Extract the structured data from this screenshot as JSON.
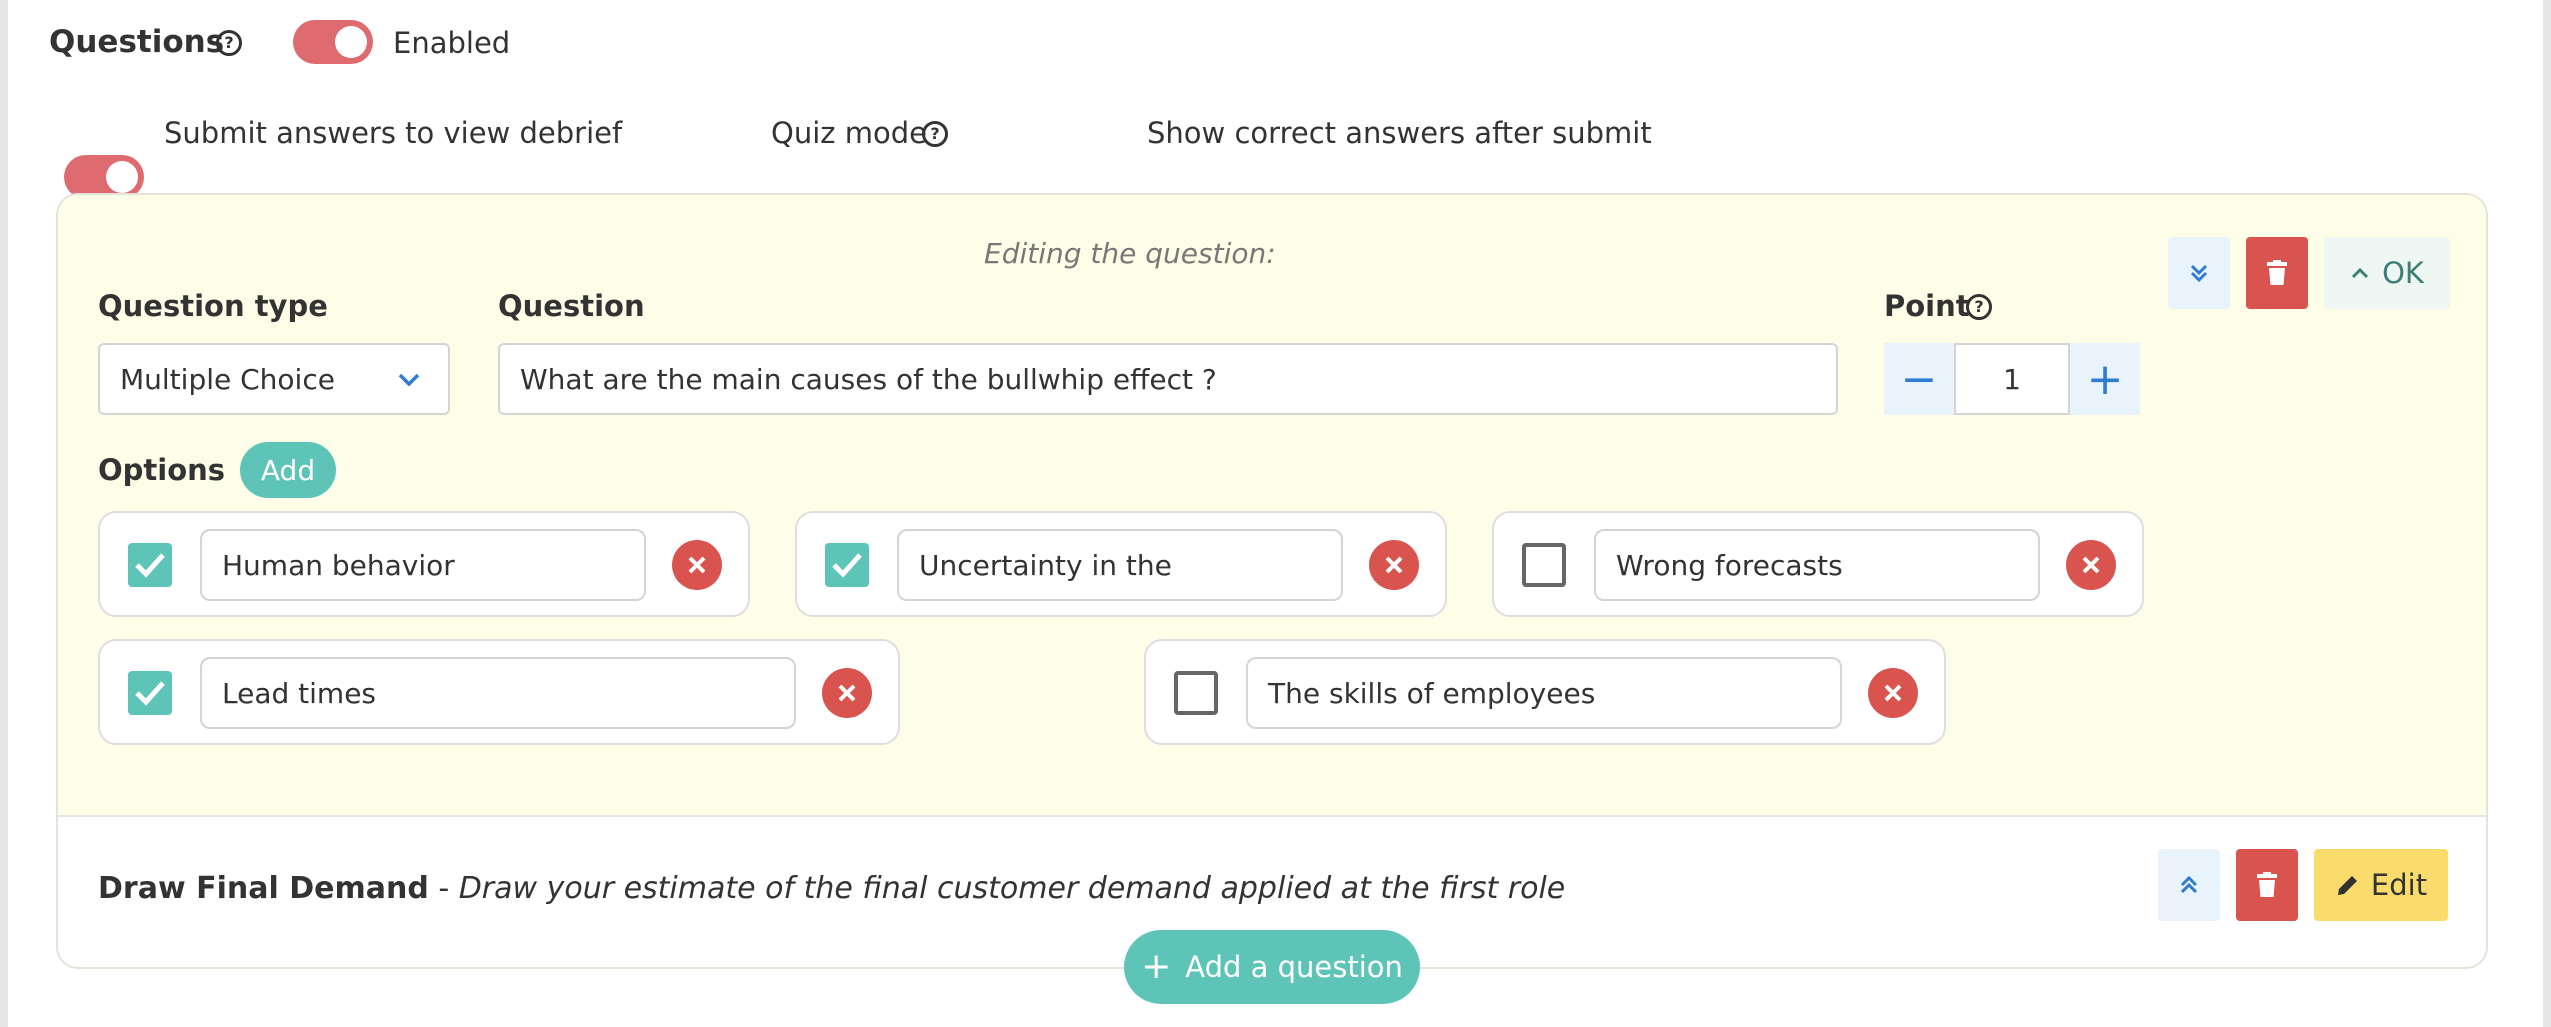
{
  "header": {
    "title": "Questions",
    "enabled_label": "Enabled"
  },
  "settings": {
    "submit_label": "Submit answers to view debrief",
    "quiz_mode_label": "Quiz mode",
    "show_correct_label": "Show correct answers after submit"
  },
  "editor": {
    "editing_caption": "Editing the question:",
    "question_type_label": "Question type",
    "question_type_value": "Multiple Choice",
    "question_label": "Question",
    "question_value": "What are the main causes of the bullwhip effect ?",
    "point_label": "Point",
    "point_value": "1",
    "minus_symbol": "−",
    "plus_symbol": "+",
    "ok_label": "OK",
    "options_label": "Options",
    "add_label": "Add",
    "options": [
      {
        "text": "Human behavior",
        "checked": true
      },
      {
        "text": "Uncertainty in the",
        "checked": true
      },
      {
        "text": "Wrong forecasts",
        "checked": false
      },
      {
        "text": "Lead times",
        "checked": true
      },
      {
        "text": "The skills of employees",
        "checked": false
      }
    ]
  },
  "second_question": {
    "title": "Draw Final Demand",
    "separator": " - ",
    "description": "Draw your estimate of the final customer demand applied at the first role",
    "edit_label": "Edit"
  },
  "add_question": {
    "label": "Add a question",
    "plus_symbol": "+"
  },
  "colors": {
    "toggle_on": "#dd6b70",
    "accent_teal": "#5ec4b8",
    "danger": "#d9534f",
    "edit_yellow": "#f9dc6b",
    "editor_bg": "#fefee8"
  }
}
